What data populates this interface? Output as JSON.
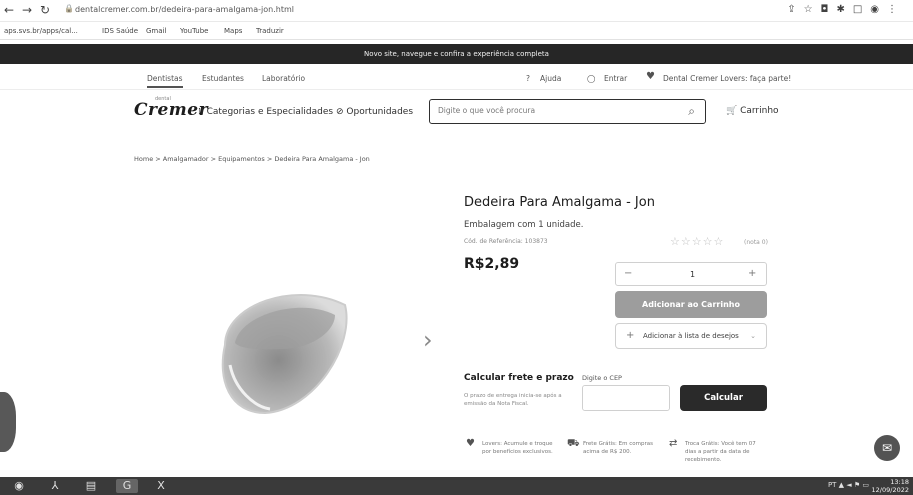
{
  "browser": {
    "url": "dentalcremer.com.br/dedeira-para-amalgama-jon.html",
    "bookmarks": [
      "aps.svs.br/apps/cal...",
      "IDS Saúde",
      "Gmail",
      "YouTube",
      "Maps",
      "Traduzir"
    ]
  },
  "site": {
    "promo": "Novo site, navegue e confira a experiência completa",
    "topnav": [
      "Dentistas",
      "Estudantes",
      "Laboratório"
    ],
    "help": "Ajuda",
    "login": "Entrar",
    "lovers": "Dental Cremer Lovers: faça parte!",
    "logo": "Cremer",
    "logo_sub": "dental",
    "categories": "Categorias e Especialidades",
    "opportunities": "Oportunidades",
    "search_placeholder": "Digite o que você procura",
    "cart": "Carrinho"
  },
  "breadcrumb": "Home  >  Amalgamador  >  Equipamentos  >  Dedeira Para Amalgama - Jon",
  "product": {
    "title": "Dedeira Para Amalgama - Jon",
    "packaging": "Embalagem com 1 unidade.",
    "reference": "Cód. de Referência: 103873",
    "price": "R$2,89",
    "quantity": "1",
    "rating_count": "(nota 0)",
    "add_to_cart": "Adicionar ao Carrinho",
    "wishlist": "Adicionar à lista de desejos"
  },
  "shipping": {
    "title": "Calcular frete e prazo",
    "description": "O prazo de entrega inicia-se após a emissão da Nota Fiscal.",
    "cep_label": "Digite o CEP",
    "calculate": "Calcular"
  },
  "benefits": [
    "Lovers: Acumule e troque por benefícios exclusivos.",
    "Frete Grátis: Em compras acima de R$ 200.",
    "Troca Grátis: Você tem 07 dias a partir da data de recebimento."
  ],
  "taskbar": {
    "lang": "PT",
    "time": "13:18",
    "date": "12/09/2022"
  }
}
